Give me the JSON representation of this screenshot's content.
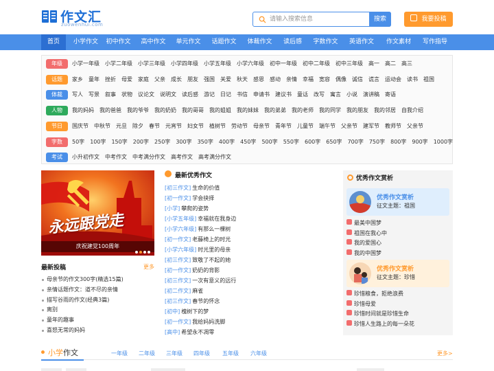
{
  "header": {
    "logo_text": "作文汇",
    "logo_sub": "zuowenhui.com",
    "search_placeholder": "请输入搜索信息",
    "search_btn": "搜索",
    "submit_btn": "我要投稿"
  },
  "nav": [
    "首页",
    "小学作文",
    "初中作文",
    "高中作文",
    "单元作文",
    "话题作文",
    "体裁作文",
    "读后感",
    "字数作文",
    "英语作文",
    "作文素材",
    "写作指导"
  ],
  "categories": [
    {
      "tag": "年级",
      "color": "#f26d6d",
      "items": [
        "小学一年级",
        "小学二年级",
        "小学三年级",
        "小学四年级",
        "小学五年级",
        "小学六年级",
        "初中一年级",
        "初中二年级",
        "初中三年级",
        "高一",
        "高二",
        "高三"
      ]
    },
    {
      "tag": "话题",
      "color": "#ff9a2e",
      "items": [
        "家乡",
        "童年",
        "挫折",
        "母爱",
        "家庭",
        "父亲",
        "成长",
        "朋友",
        "强国",
        "关爱",
        "秋天",
        "感恩",
        "感动",
        "亲情",
        "幸福",
        "宽容",
        "偶像",
        "诚信",
        "谎言",
        "运动会",
        "读书",
        "祖国"
      ]
    },
    {
      "tag": "体裁",
      "color": "#4a8fe8",
      "items": [
        "写人",
        "写景",
        "叙事",
        "状物",
        "议论文",
        "说明文",
        "读后感",
        "游记",
        "日记",
        "书信",
        "申请书",
        "建议书",
        "童话",
        "改写",
        "寓言",
        "小说",
        "演讲稿",
        "寄语"
      ]
    },
    {
      "tag": "人物",
      "color": "#2eaa5c",
      "items": [
        "我的妈妈",
        "我的爸爸",
        "我的爷爷",
        "我的奶奶",
        "我的哥哥",
        "我的姐姐",
        "我的妹妹",
        "我的弟弟",
        "我的老师",
        "我的同学",
        "我的朋友",
        "我的邻居",
        "自我介绍"
      ]
    },
    {
      "tag": "节日",
      "color": "#ff9a2e",
      "items": [
        "国庆节",
        "中秋节",
        "元旦",
        "除夕",
        "春节",
        "元宵节",
        "妇女节",
        "植树节",
        "劳动节",
        "母亲节",
        "青年节",
        "儿童节",
        "端午节",
        "父亲节",
        "建军节",
        "教师节",
        "父亲节"
      ]
    },
    {
      "tag": "字数",
      "color": "#f26d6d",
      "items": [
        "50字",
        "100字",
        "150字",
        "200字",
        "250字",
        "300字",
        "350字",
        "400字",
        "450字",
        "500字",
        "550字",
        "600字",
        "650字",
        "700字",
        "750字",
        "800字",
        "900字",
        "1000字"
      ]
    },
    {
      "tag": "考试",
      "color": "#4a8fe8",
      "items": [
        "小升初作文",
        "中考作文",
        "中考满分作文",
        "高考作文",
        "高考满分作文"
      ]
    }
  ],
  "banner": {
    "calligraphy": "永远跟党走",
    "caption": "庆祝建党100周年"
  },
  "latest": {
    "title": "最新投稿",
    "more": "更多",
    "items": [
      "母亲节的作文300字(精选15篇)",
      "亲情话题作文：道不尽的亲情",
      "描写谷雨的作文(经典3篇)",
      "离别",
      "童年的趣事",
      "喜怒无常的妈妈"
    ]
  },
  "best_new": {
    "title": "最新优秀作文",
    "items": [
      {
        "grade": "[初三作文]",
        "title": "生命的价值"
      },
      {
        "grade": "[初一作文]",
        "title": "学会抉择"
      },
      {
        "grade": "[小学]",
        "title": "攀爬的姿势"
      },
      {
        "grade": "[小学五年级]",
        "title": "幸福就在我身边"
      },
      {
        "grade": "[小学六年级]",
        "title": "有那么一棵树"
      },
      {
        "grade": "[初一作文]",
        "title": "老藤椅上的时光"
      },
      {
        "grade": "[小学六年级]",
        "title": "时光里的母亲"
      },
      {
        "grade": "[初三作文]",
        "title": "致敬了不起的她"
      },
      {
        "grade": "[初一作文]",
        "title": "奶奶的背影"
      },
      {
        "grade": "[初三作文]",
        "title": "一次有意义的远行"
      },
      {
        "grade": "[初二作文]",
        "title": "麻雀"
      },
      {
        "grade": "[初三作文]",
        "title": "春节的怀念"
      },
      {
        "grade": "[初中]",
        "title": "槐树下的梦"
      },
      {
        "grade": "[初一作文]",
        "title": "我给妈妈洗脚"
      },
      {
        "grade": "[高中]",
        "title": "希望永不凋零"
      }
    ]
  },
  "appreciation": {
    "title": "优秀作文赏析",
    "cards": [
      {
        "title": "优秀作文赏析",
        "subtitle": "征文主题：祖国",
        "items": [
          "最美中国梦",
          "祖国在我心中",
          "我的爱国心",
          "我的中国梦"
        ]
      },
      {
        "title": "优秀作文赏析",
        "subtitle": "征文主题：珍惜",
        "items": [
          "珍惜粮食，拒绝浪费",
          "珍惜母爱",
          "珍惜时间就是珍惜生命",
          "珍惜人生路上的每一朵花"
        ]
      }
    ]
  },
  "bottom": {
    "title_a": "小学",
    "title_b": "作文",
    "tabs": [
      "一年级",
      "二年级",
      "三年级",
      "四年级",
      "五年级",
      "六年级"
    ],
    "more": "更多>"
  }
}
